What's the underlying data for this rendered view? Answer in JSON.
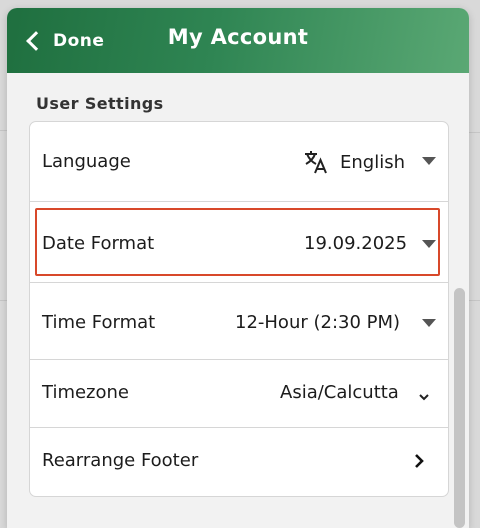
{
  "header": {
    "back_label": "Done",
    "title": "My Account"
  },
  "section": {
    "title": "User Settings"
  },
  "settings": [
    {
      "label": "Language",
      "value": "English",
      "icon": "translate-icon",
      "control": "dropdown"
    },
    {
      "label": "Date Format",
      "value": "19.09.2025",
      "control": "dropdown",
      "highlighted": true
    },
    {
      "label": "Time Format",
      "value": "12-Hour (2:30 PM)",
      "control": "dropdown"
    },
    {
      "label": "Timezone",
      "value": "Asia/Calcutta",
      "control": "chevron-down"
    },
    {
      "label": "Rearrange Footer",
      "value": "",
      "control": "chevron-right"
    }
  ],
  "colors": {
    "header_start": "#1f6f3f",
    "header_end": "#5aa874",
    "highlight": "#d8482a"
  }
}
